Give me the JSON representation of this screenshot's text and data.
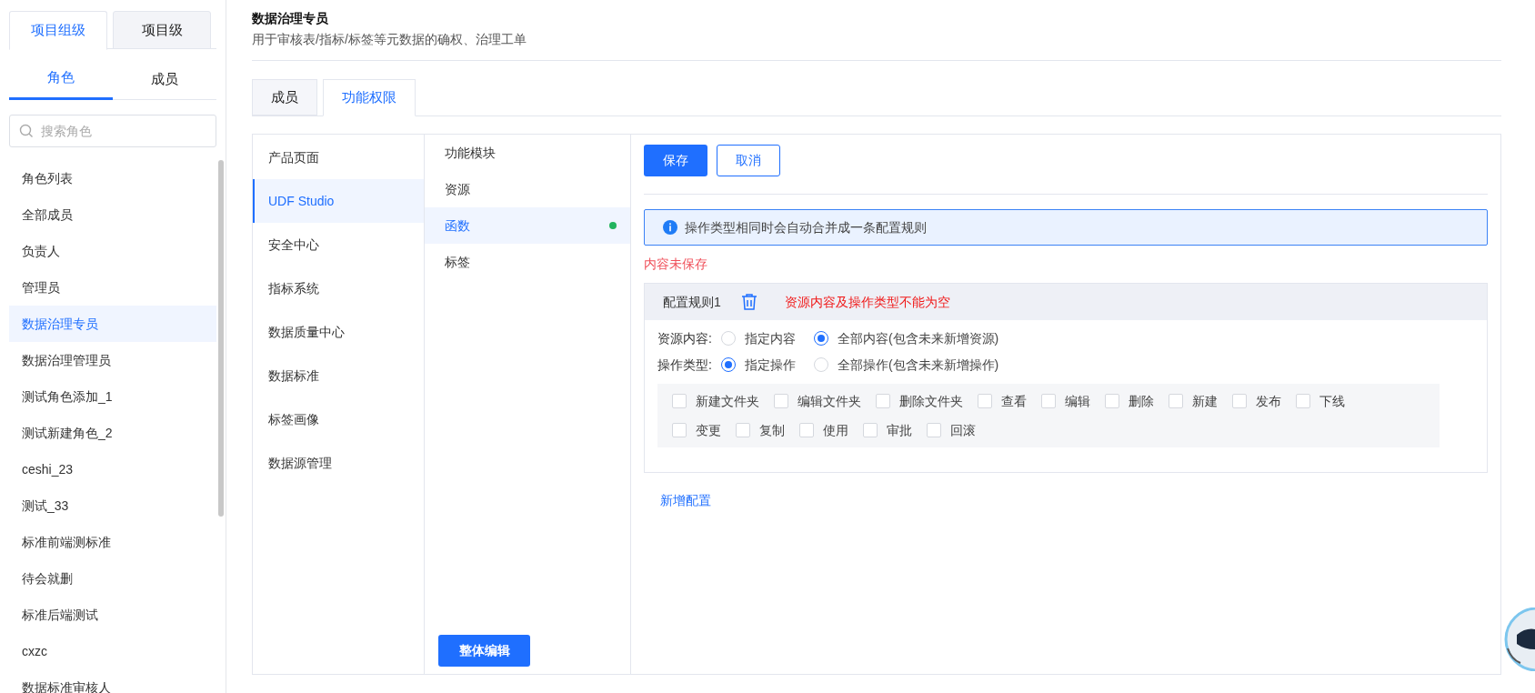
{
  "scope_tabs": [
    {
      "label": "项目组级",
      "selected": true
    },
    {
      "label": "项目级",
      "selected": false
    }
  ],
  "sub_tabs": [
    {
      "label": "角色",
      "selected": true
    },
    {
      "label": "成员",
      "selected": false
    }
  ],
  "search": {
    "placeholder": "搜索角色"
  },
  "roles": [
    {
      "label": "角色列表",
      "selected": false
    },
    {
      "label": "全部成员",
      "selected": false
    },
    {
      "label": "负责人",
      "selected": false
    },
    {
      "label": "管理员",
      "selected": false
    },
    {
      "label": "数据治理专员",
      "selected": true
    },
    {
      "label": "数据治理管理员",
      "selected": false
    },
    {
      "label": "测试角色添加_1",
      "selected": false
    },
    {
      "label": "测试新建角色_2",
      "selected": false
    },
    {
      "label": "ceshi_23",
      "selected": false
    },
    {
      "label": "测试_33",
      "selected": false
    },
    {
      "label": "标准前端测标准",
      "selected": false
    },
    {
      "label": "待会就删",
      "selected": false
    },
    {
      "label": "标准后端测试",
      "selected": false
    },
    {
      "label": "cxzc",
      "selected": false
    },
    {
      "label": "数据标准审核人",
      "selected": false
    }
  ],
  "header": {
    "title": "数据治理专员",
    "description": "用于审核表/指标/标签等元数据的确权、治理工单"
  },
  "main_tabs": [
    {
      "label": "成员",
      "selected": false
    },
    {
      "label": "功能权限",
      "selected": true
    }
  ],
  "products": [
    {
      "label": "产品页面",
      "selected": false
    },
    {
      "label": "UDF Studio",
      "selected": true
    },
    {
      "label": "安全中心",
      "selected": false
    },
    {
      "label": "指标系统",
      "selected": false
    },
    {
      "label": "数据质量中心",
      "selected": false
    },
    {
      "label": "数据标准",
      "selected": false
    },
    {
      "label": "标签画像",
      "selected": false
    },
    {
      "label": "数据源管理",
      "selected": false
    }
  ],
  "modules": {
    "heading": "功能模块",
    "items": [
      {
        "label": "资源",
        "selected": false,
        "modified": false
      },
      {
        "label": "函数",
        "selected": true,
        "modified": true
      },
      {
        "label": "标签",
        "selected": false,
        "modified": false
      }
    ],
    "edit_button": "整体编辑"
  },
  "actions": {
    "save": "保存",
    "cancel": "取消"
  },
  "alert": "操作类型相同时会自动合并成一条配置规则",
  "unsaved": "内容未保存",
  "rule": {
    "title": "配置规则1",
    "error": "资源内容及操作类型不能为空",
    "resource": {
      "label": "资源内容:",
      "options": [
        {
          "label": "指定内容",
          "selected": false
        },
        {
          "label": "全部内容(包含未来新增资源)",
          "selected": true
        }
      ]
    },
    "operation": {
      "label": "操作类型:",
      "options": [
        {
          "label": "指定操作",
          "selected": true
        },
        {
          "label": "全部操作(包含未来新增操作)",
          "selected": false
        }
      ]
    },
    "operations": [
      {
        "label": "新建文件夹",
        "checked": false
      },
      {
        "label": "编辑文件夹",
        "checked": false
      },
      {
        "label": "删除文件夹",
        "checked": false
      },
      {
        "label": "查看",
        "checked": false
      },
      {
        "label": "编辑",
        "checked": false
      },
      {
        "label": "删除",
        "checked": false
      },
      {
        "label": "新建",
        "checked": false
      },
      {
        "label": "发布",
        "checked": false
      },
      {
        "label": "下线",
        "checked": false
      },
      {
        "label": "变更",
        "checked": false
      },
      {
        "label": "复制",
        "checked": false
      },
      {
        "label": "使用",
        "checked": false
      },
      {
        "label": "审批",
        "checked": false
      },
      {
        "label": "回滚",
        "checked": false
      }
    ]
  },
  "add_config": "新增配置"
}
